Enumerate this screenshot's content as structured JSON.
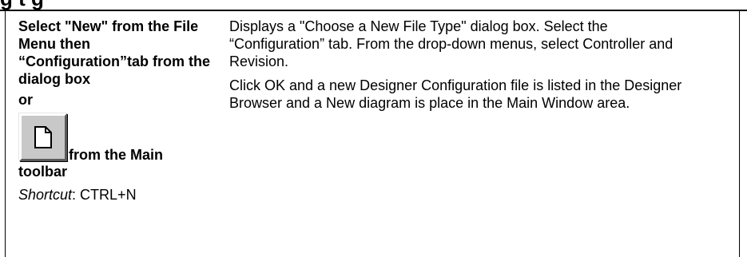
{
  "heading_fragment": "g   t   g",
  "left_column": {
    "instruction": "Select \"New\" from the File Menu then “Configuration”tab from the dialog box",
    "or": "or",
    "toolbar_suffix": "from the Main",
    "toolbar_tail": "toolbar",
    "shortcut_label": "Shortcut",
    "shortcut_value": ": CTRL+N",
    "new_button_icon": "new-document-icon"
  },
  "right_column": {
    "paragraph1": "Displays a \"Choose a New File Type\" dialog box. Select the “Configuration” tab. From the drop-down menus, select Controller and Revision.",
    "paragraph2": "Click OK and a new Designer Configuration file is listed in the Designer Browser and a New diagram is place in the Main Window area."
  }
}
